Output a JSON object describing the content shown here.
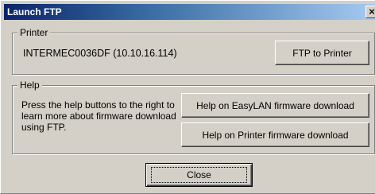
{
  "window": {
    "title": "Launch FTP",
    "close_glyph": "×"
  },
  "printer_group": {
    "legend": "Printer",
    "printer_name": "INTERMEC0036DF (10.10.16.114)",
    "ftp_button": "FTP to Printer"
  },
  "help_group": {
    "legend": "Help",
    "text": "Press the help buttons to the right to learn more about firmware download using FTP.",
    "easylan_button": "Help on EasyLAN firmware download",
    "printer_button": "Help on Printer firmware download"
  },
  "footer": {
    "close_button": "Close"
  }
}
